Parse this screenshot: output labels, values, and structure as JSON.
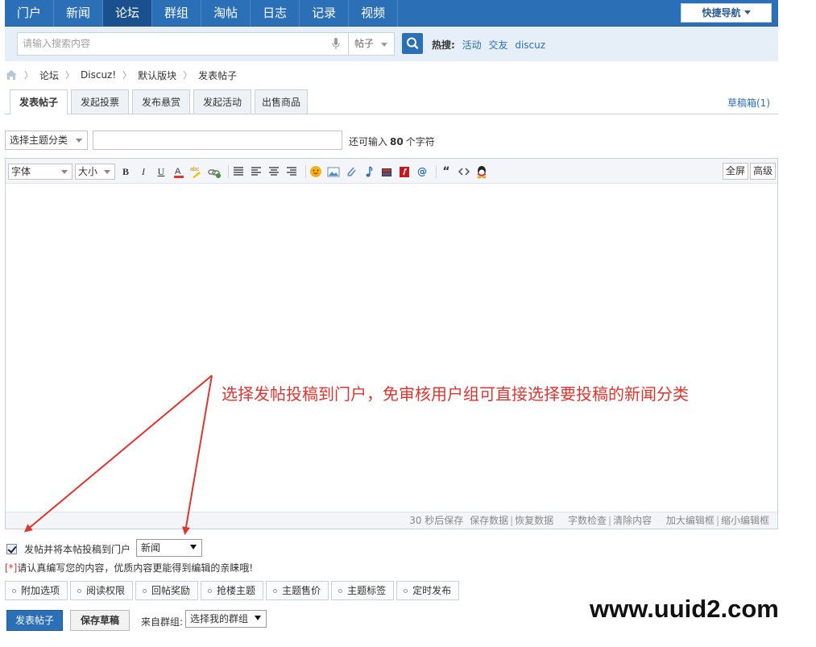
{
  "nav": {
    "items": [
      "门户",
      "新闻",
      "论坛",
      "群组",
      "淘帖",
      "日志",
      "记录",
      "视频"
    ],
    "active_index": 2,
    "quick_nav": "快捷导航"
  },
  "search": {
    "placeholder": "请输入搜索内容",
    "scope": "帖子",
    "hot_label": "热搜:",
    "hot_terms": [
      "活动",
      "交友",
      "discuz"
    ]
  },
  "breadcrumb": [
    "论坛",
    "Discuz!",
    "默认版块",
    "发表帖子"
  ],
  "tabs": [
    "发表帖子",
    "发起投票",
    "发布悬赏",
    "发起活动",
    "出售商品"
  ],
  "drafts_link": "草稿箱(1)",
  "subject": {
    "type_select": "选择主题分类",
    "remain_prefix": "还可输入",
    "remain_count": "80",
    "remain_suffix": "个字符"
  },
  "editor": {
    "font_select": "字体",
    "size_select": "大小",
    "fullscreen": "全屏",
    "advanced": "高级",
    "status": {
      "autosave": "30 秒后保存",
      "save_data": "保存数据",
      "restore_data": "恢复数据",
      "word_check": "字数检查",
      "clear": "清除内容",
      "enlarge": "加大编辑框",
      "shrink": "缩小编辑框"
    },
    "icons": [
      "bold-icon",
      "italic-icon",
      "underline-icon",
      "font-color-icon",
      "background-color-icon",
      "link-icon",
      "justify-icon",
      "align-left-icon",
      "align-center-icon",
      "align-right-icon",
      "smiley-icon",
      "image-icon",
      "attachment-icon",
      "music-icon",
      "video-icon",
      "flash-icon",
      "at-icon",
      "quote-icon",
      "code-icon",
      "qq-icon"
    ]
  },
  "annotation": "选择发帖投稿到门户，免审核用户组可直接选择要投稿的新闻分类",
  "portal": {
    "checkbox_label": "发帖并将本帖投稿到门户",
    "checked": true,
    "category": "新闻"
  },
  "notice": {
    "star": "[*]",
    "text": "请认真编写您的内容，优质内容更能得到编辑的亲睐哦!"
  },
  "options": [
    "附加选项",
    "阅读权限",
    "回帖奖励",
    "抢楼主题",
    "主题售价",
    "主题标签",
    "定时发布"
  ],
  "actions": {
    "submit": "发表帖子",
    "save_draft": "保存草稿",
    "from_group_label": "来自群组:",
    "group_select": "选择我的群组"
  },
  "watermark": "www.uuid2.com",
  "colors": {
    "nav_blue": "#2b6fb6",
    "nav_active": "#19508d",
    "annotation_red": "#e0352f",
    "link_blue": "#2b6fb6"
  }
}
